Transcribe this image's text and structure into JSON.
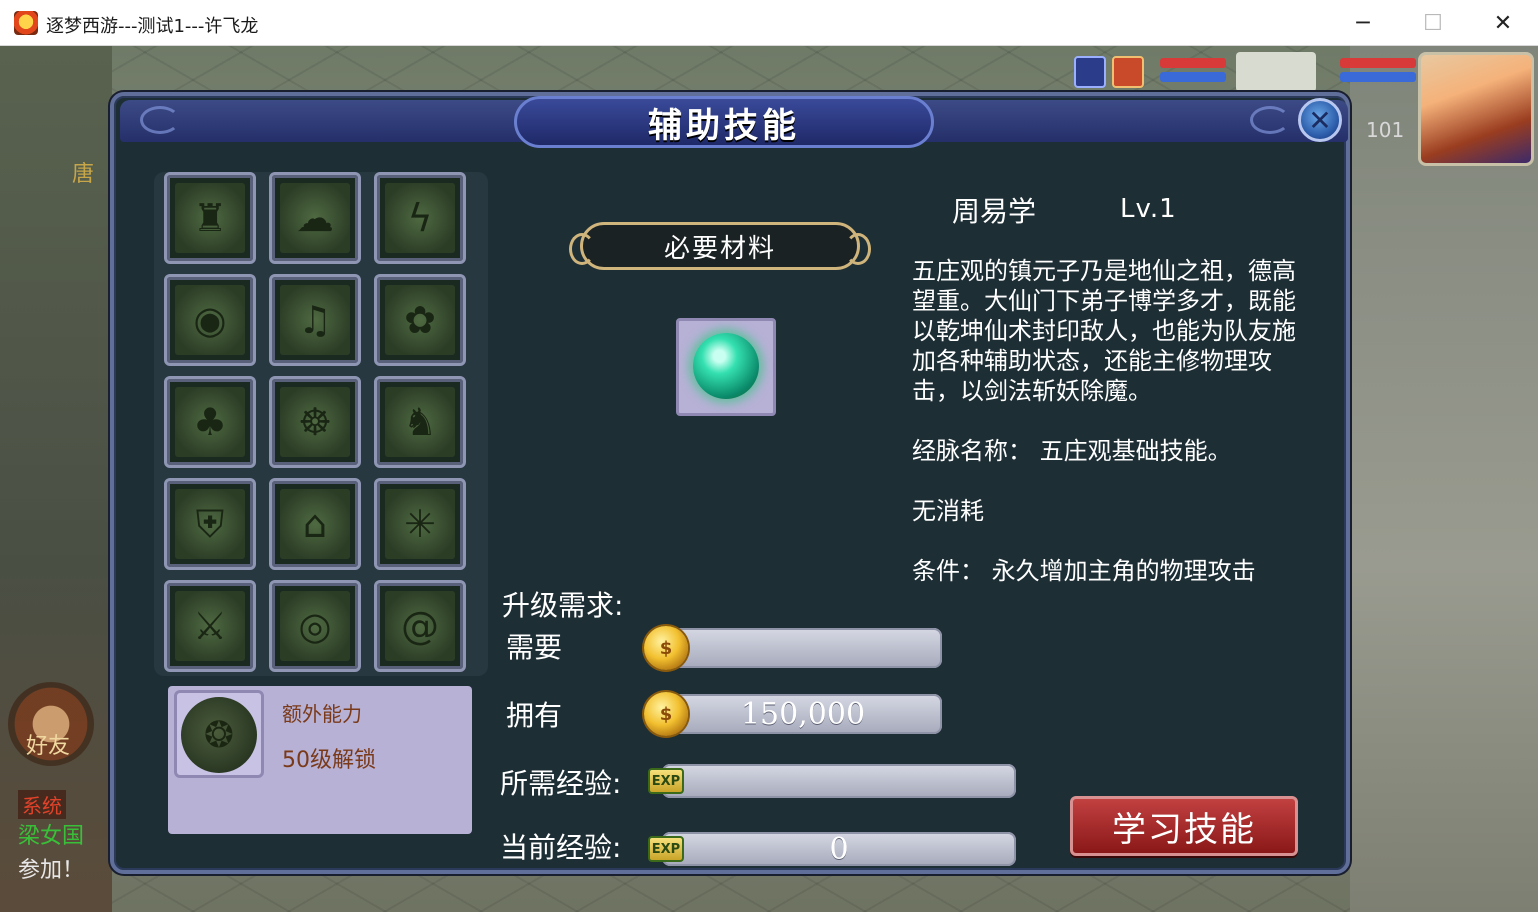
{
  "window": {
    "title": "逐梦西游---测试1---许飞龙",
    "minimize": "─",
    "maximize": "☐",
    "close": "✕"
  },
  "background": {
    "left_text": "唐",
    "player_level": "101",
    "friend_label": "好友",
    "chat": [
      "系统",
      "梁女国",
      "参加！"
    ]
  },
  "panel": {
    "title": "辅助技能",
    "close_glyph": "✕"
  },
  "skills": [
    {
      "icon": "warrior-icon",
      "glyph": "♜"
    },
    {
      "icon": "cloud-icon",
      "glyph": "☁"
    },
    {
      "icon": "lightning-icon",
      "glyph": "ϟ"
    },
    {
      "icon": "eyes-icon",
      "glyph": "◉"
    },
    {
      "icon": "wind-swirl-icon",
      "glyph": "♫"
    },
    {
      "icon": "flower-icon",
      "glyph": "✿"
    },
    {
      "icon": "tree-icon",
      "glyph": "♣"
    },
    {
      "icon": "monk-icon",
      "glyph": "☸"
    },
    {
      "icon": "figure-icon",
      "glyph": "♞"
    },
    {
      "icon": "shield-icon",
      "glyph": "⛨"
    },
    {
      "icon": "arch-icon",
      "glyph": "⌂"
    },
    {
      "icon": "shatter-icon",
      "glyph": "✳"
    },
    {
      "icon": "sword-icon",
      "glyph": "⚔"
    },
    {
      "icon": "angry-eyes-icon",
      "glyph": "◎"
    },
    {
      "icon": "spiral-icon",
      "glyph": "@"
    }
  ],
  "extra": {
    "label": "额外能力",
    "unlock": "50级解锁",
    "icon": "dragon-orb-icon",
    "glyph": "❂"
  },
  "materials": {
    "title": "必要材料",
    "item_icon": "jade-orb-icon"
  },
  "selected_skill": {
    "name": "周易学",
    "level": "Lv.1",
    "description": "五庄观的镇元子乃是地仙之祖，德高望重。大仙门下弟子博学多才，既能以乾坤仙术封印敌人，也能为队友施加各种辅助状态，还能主修物理攻击，以剑法斩妖除魔。",
    "meridian": "经脉名称：  五庄观基础技能。",
    "cost": "无消耗",
    "condition": "条件：  永久增加主角的物理攻击"
  },
  "requirements": {
    "title": "升级需求:",
    "need_label": "需要",
    "need_value": "",
    "have_label": "拥有",
    "have_value": "150,000",
    "exp_need_label": "所需经验:",
    "exp_need_value": "",
    "exp_cur_label": "当前经验:",
    "exp_cur_value": "0",
    "coin_glyph": "$",
    "exp_glyph": "EXP"
  },
  "actions": {
    "learn": "学习技能"
  }
}
